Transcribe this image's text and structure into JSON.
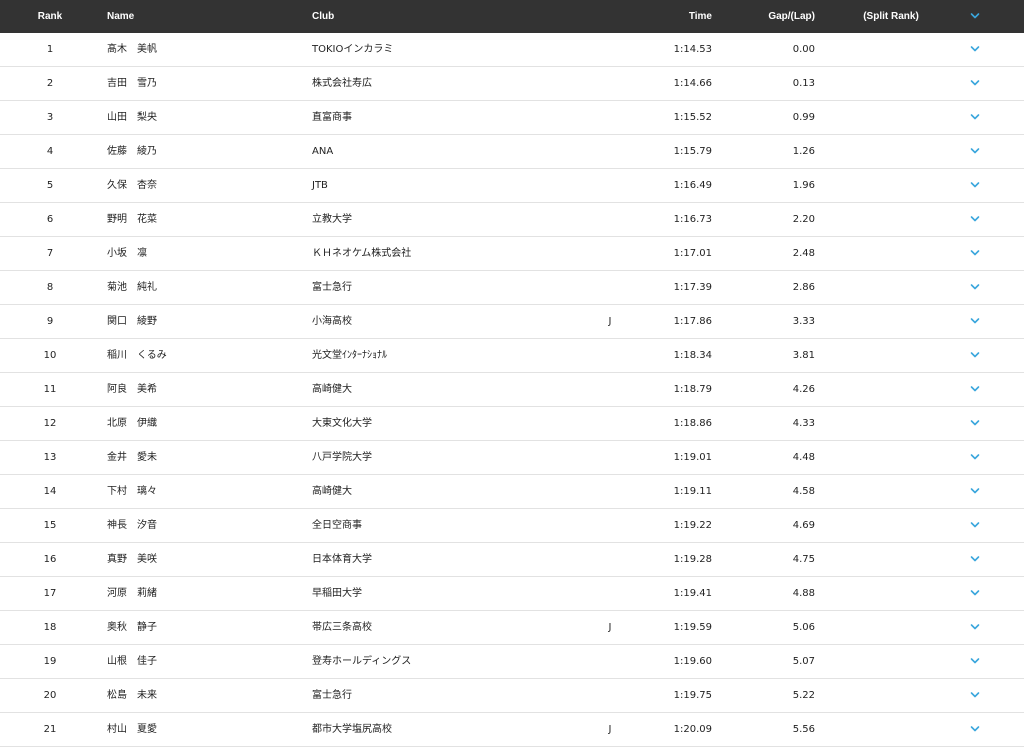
{
  "header": {
    "rank": "Rank",
    "name": "Name",
    "club": "Club",
    "time": "Time",
    "gap": "Gap/(Lap)",
    "split_rank": "(Split Rank)",
    "toggle_icon": "chevron-down-icon"
  },
  "colors": {
    "header_bg": "#333333",
    "header_text": "#ffffff",
    "chevron": "#3aa6dc",
    "divider": "#e2e2e2"
  },
  "rows": [
    {
      "rank": "1",
      "name": "髙木　美帆",
      "club": "TOKIOインカラミ",
      "junior": "",
      "time": "1:14.53",
      "gap": "0.00"
    },
    {
      "rank": "2",
      "name": "吉田　雪乃",
      "club": "株式会社寿広",
      "junior": "",
      "time": "1:14.66",
      "gap": "0.13"
    },
    {
      "rank": "3",
      "name": "山田　梨央",
      "club": "直富商事",
      "junior": "",
      "time": "1:15.52",
      "gap": "0.99"
    },
    {
      "rank": "4",
      "name": "佐藤　綾乃",
      "club": "ANA",
      "junior": "",
      "time": "1:15.79",
      "gap": "1.26"
    },
    {
      "rank": "5",
      "name": "久保　杏奈",
      "club": "JTB",
      "junior": "",
      "time": "1:16.49",
      "gap": "1.96"
    },
    {
      "rank": "6",
      "name": "野明　花菜",
      "club": "立教大学",
      "junior": "",
      "time": "1:16.73",
      "gap": "2.20"
    },
    {
      "rank": "7",
      "name": "小坂　凛",
      "club": "ＫＨネオケム株式会社",
      "junior": "",
      "time": "1:17.01",
      "gap": "2.48"
    },
    {
      "rank": "8",
      "name": "菊池　純礼",
      "club": "富士急行",
      "junior": "",
      "time": "1:17.39",
      "gap": "2.86"
    },
    {
      "rank": "9",
      "name": "関口　綾野",
      "club": "小海高校",
      "junior": "J",
      "time": "1:17.86",
      "gap": "3.33"
    },
    {
      "rank": "10",
      "name": "稲川　くるみ",
      "club": "光文堂ｲﾝﾀｰﾅｼｮﾅﾙ",
      "junior": "",
      "time": "1:18.34",
      "gap": "3.81"
    },
    {
      "rank": "11",
      "name": "阿良　美希",
      "club": "高崎健大",
      "junior": "",
      "time": "1:18.79",
      "gap": "4.26"
    },
    {
      "rank": "12",
      "name": "北原　伊織",
      "club": "大東文化大学",
      "junior": "",
      "time": "1:18.86",
      "gap": "4.33"
    },
    {
      "rank": "13",
      "name": "金井　愛未",
      "club": "八戸学院大学",
      "junior": "",
      "time": "1:19.01",
      "gap": "4.48"
    },
    {
      "rank": "14",
      "name": "下村　璃々",
      "club": "高崎健大",
      "junior": "",
      "time": "1:19.11",
      "gap": "4.58"
    },
    {
      "rank": "15",
      "name": "神長　汐音",
      "club": "全日空商事",
      "junior": "",
      "time": "1:19.22",
      "gap": "4.69"
    },
    {
      "rank": "16",
      "name": "真野　美咲",
      "club": "日本体育大学",
      "junior": "",
      "time": "1:19.28",
      "gap": "4.75"
    },
    {
      "rank": "17",
      "name": "河原　莉緒",
      "club": "早稲田大学",
      "junior": "",
      "time": "1:19.41",
      "gap": "4.88"
    },
    {
      "rank": "18",
      "name": "奥秋　静子",
      "club": "帯広三条高校",
      "junior": "J",
      "time": "1:19.59",
      "gap": "5.06"
    },
    {
      "rank": "19",
      "name": "山根　佳子",
      "club": "登寿ホールディングス",
      "junior": "",
      "time": "1:19.60",
      "gap": "5.07"
    },
    {
      "rank": "20",
      "name": "松島　未来",
      "club": "富士急行",
      "junior": "",
      "time": "1:19.75",
      "gap": "5.22"
    },
    {
      "rank": "21",
      "name": "村山　夏愛",
      "club": "都市大学塩尻高校",
      "junior": "J",
      "time": "1:20.09",
      "gap": "5.56"
    }
  ]
}
